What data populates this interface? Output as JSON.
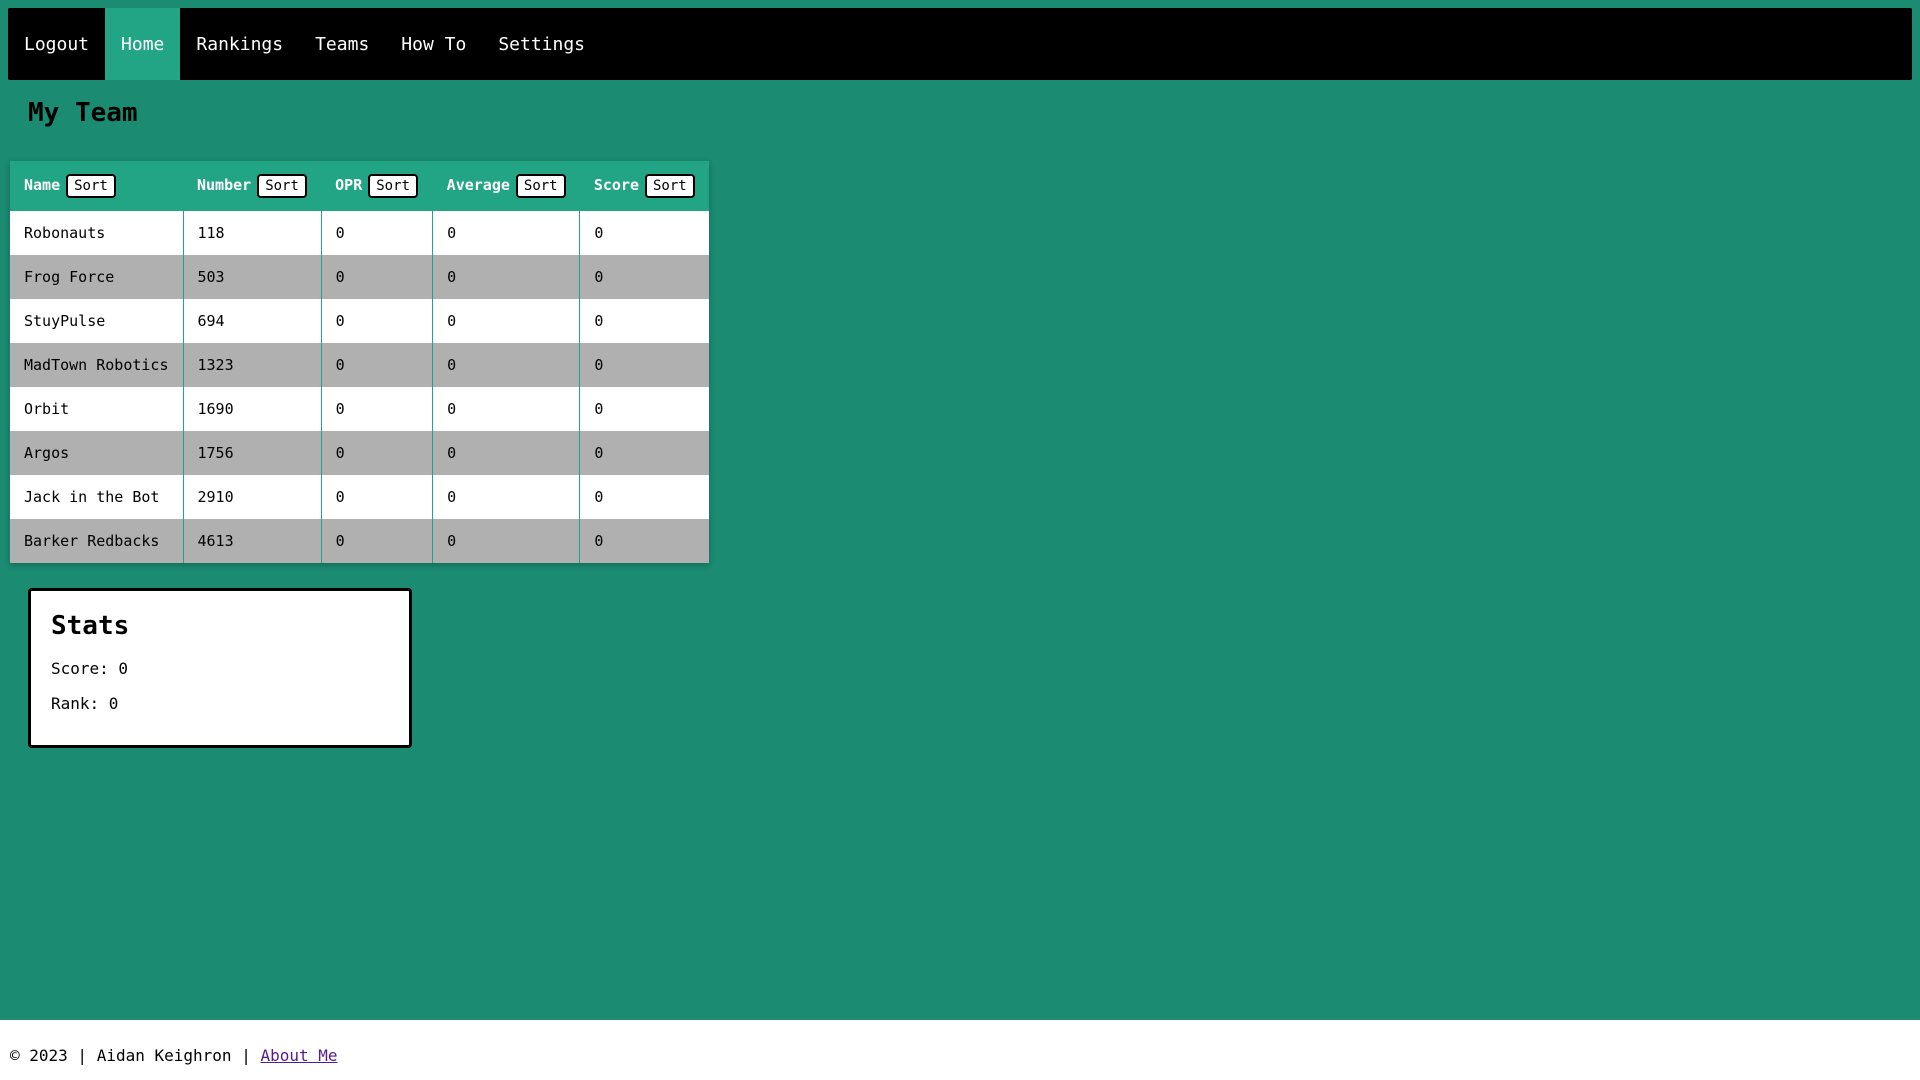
{
  "nav": {
    "items": [
      {
        "label": "Logout",
        "active": false
      },
      {
        "label": "Home",
        "active": true
      },
      {
        "label": "Rankings",
        "active": false
      },
      {
        "label": "Teams",
        "active": false
      },
      {
        "label": "How To",
        "active": false
      },
      {
        "label": "Settings",
        "active": false
      }
    ]
  },
  "page": {
    "title": "My Team"
  },
  "table": {
    "sort_label": "Sort",
    "columns": [
      "Name",
      "Number",
      "OPR",
      "Average",
      "Score"
    ],
    "rows": [
      [
        "Robonauts",
        "118",
        "0",
        "0",
        "0"
      ],
      [
        "Frog Force",
        "503",
        "0",
        "0",
        "0"
      ],
      [
        "StuyPulse",
        "694",
        "0",
        "0",
        "0"
      ],
      [
        "MadTown Robotics",
        "1323",
        "0",
        "0",
        "0"
      ],
      [
        "Orbit",
        "1690",
        "0",
        "0",
        "0"
      ],
      [
        "Argos",
        "1756",
        "0",
        "0",
        "0"
      ],
      [
        "Jack in the Bot",
        "2910",
        "0",
        "0",
        "0"
      ],
      [
        "Barker Redbacks",
        "4613",
        "0",
        "0",
        "0"
      ]
    ]
  },
  "stats": {
    "title": "Stats",
    "score": "Score: 0",
    "rank": "Rank: 0"
  },
  "footer": {
    "text": "© 2023 | Aidan Keighron | ",
    "link": "About Me"
  },
  "colors": {
    "background": "#1b8b72",
    "accent": "#22a585",
    "nav_bg": "#000000",
    "row_alt": "#b0b0b0"
  }
}
